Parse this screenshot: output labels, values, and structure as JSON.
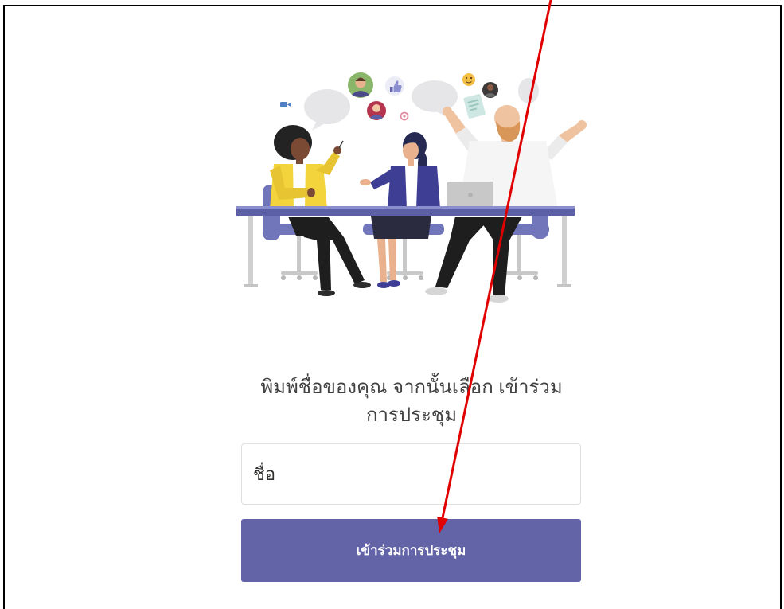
{
  "colors": {
    "accent": "#6264A7",
    "button_text": "#FFFFFF",
    "prompt_text": "#424242",
    "input_border": "#E1DFDD",
    "frame": "#000000",
    "annotation_arrow": "#E00000"
  },
  "illustration": {
    "icons": [
      "video-camera-icon",
      "avatar-icon",
      "thumbs-up-icon",
      "at-sign-icon",
      "emoji-icon",
      "document-icon"
    ]
  },
  "prompt": {
    "line1": "พิมพ์ชื่อของคุณ จากนั้นเลือก เข้าร่วม",
    "line2": "การประชุม"
  },
  "name_input": {
    "placeholder": "ชื่อ",
    "value": ""
  },
  "join_button": {
    "label": "เข้าร่วมการประชุม"
  }
}
